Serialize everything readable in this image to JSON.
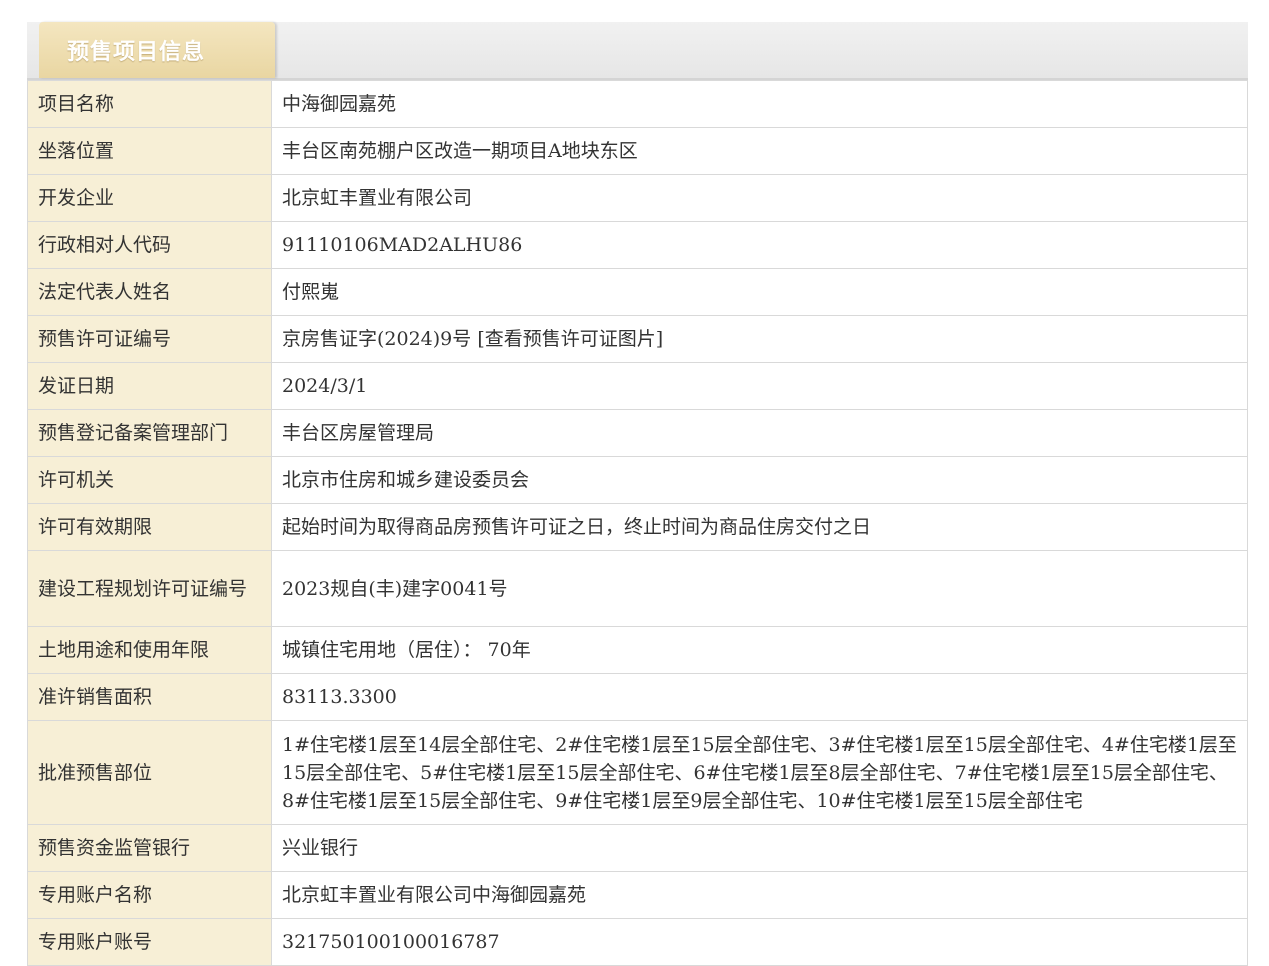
{
  "section": {
    "title": "预售项目信息"
  },
  "rows": [
    {
      "label": "项目名称",
      "value": "中海御园嘉苑"
    },
    {
      "label": "坐落位置",
      "value": "丰台区南苑棚户区改造一期项目A地块东区"
    },
    {
      "label": "开发企业",
      "value": "北京虹丰置业有限公司"
    },
    {
      "label": "行政相对人代码",
      "value": "91110106MAD2ALHU86"
    },
    {
      "label": "法定代表人姓名",
      "value": "付熙嵬"
    },
    {
      "label": "预售许可证编号",
      "value": "京房售证字(2024)9号",
      "link": "[查看预售许可证图片]"
    },
    {
      "label": "发证日期",
      "value": "2024/3/1"
    },
    {
      "label": "预售登记备案管理部门",
      "value": "丰台区房屋管理局"
    },
    {
      "label": "许可机关",
      "value": "北京市住房和城乡建设委员会"
    },
    {
      "label": "许可有效期限",
      "value": "起始时间为取得商品房预售许可证之日，终止时间为商品住房交付之日"
    },
    {
      "label": "建设工程规划许可证编号",
      "value": "2023规自(丰)建字0041号"
    },
    {
      "label": "土地用途和使用年限",
      "value": "城镇住宅用地（居住）： 70年"
    },
    {
      "label": "准许销售面积",
      "value": "83113.3300"
    },
    {
      "label": "批准预售部位",
      "value": "1#住宅楼1层至14层全部住宅、2#住宅楼1层至15层全部住宅、3#住宅楼1层至15层全部住宅、4#住宅楼1层至15层全部住宅、5#住宅楼1层至15层全部住宅、6#住宅楼1层至8层全部住宅、7#住宅楼1层至15层全部住宅、8#住宅楼1层至15层全部住宅、9#住宅楼1层至9层全部住宅、10#住宅楼1层至15层全部住宅"
    },
    {
      "label": "预售资金监管银行",
      "value": "兴业银行"
    },
    {
      "label": "专用账户名称",
      "value": "北京虹丰置业有限公司中海御园嘉苑"
    },
    {
      "label": "专用账户账号",
      "value": "321750100100016787"
    }
  ]
}
